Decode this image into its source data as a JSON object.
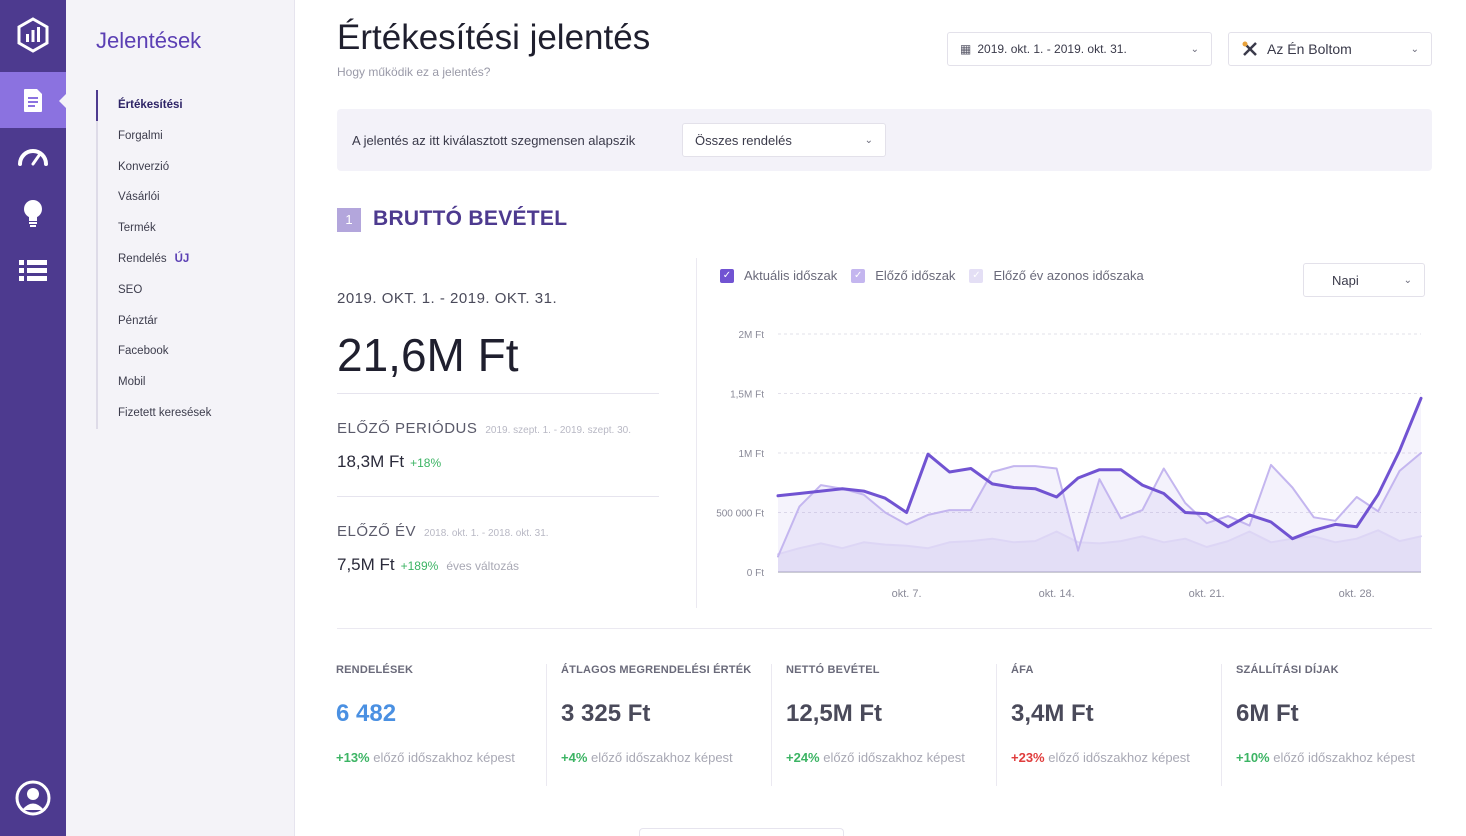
{
  "sidebar": {
    "title": "Jelentések",
    "items": [
      {
        "label": "Értékesítési",
        "active": true
      },
      {
        "label": "Forgalmi"
      },
      {
        "label": "Konverzió"
      },
      {
        "label": "Vásárlói"
      },
      {
        "label": "Termék"
      },
      {
        "label": "Rendelés",
        "badge": "ÚJ"
      },
      {
        "label": "SEO"
      },
      {
        "label": "Pénztár"
      },
      {
        "label": "Facebook"
      },
      {
        "label": "Mobil"
      },
      {
        "label": "Fizetett keresések"
      }
    ]
  },
  "header": {
    "title": "Értékesítési jelentés",
    "subtitle": "Hogy működik ez a jelentés?",
    "date_range": "2019. okt. 1. - 2019. okt. 31.",
    "shop": "Az Én Boltom"
  },
  "segment": {
    "label": "A jelentés az itt kiválasztott szegmensen alapszik",
    "value": "Összes rendelés"
  },
  "section": {
    "number": "1",
    "title": "BRUTTÓ BEVÉTEL"
  },
  "summary": {
    "range": "2019. OKT. 1. - 2019. OKT. 31.",
    "value": "21,6M Ft",
    "prev_period": {
      "label": "ELŐZŐ PERIÓDUS",
      "range": "2019. szept. 1. - 2019. szept. 30.",
      "value": "18,3M Ft",
      "change": "+18%"
    },
    "prev_year": {
      "label": "ELŐZŐ ÉV",
      "range": "2018. okt. 1. - 2018. okt. 31.",
      "value": "7,5M Ft",
      "change": "+189%",
      "note": "éves változás"
    }
  },
  "chart_legend": {
    "current": "Aktuális időszak",
    "previous": "Előző időszak",
    "prev_year": "Előző év azonos időszaka",
    "granularity": "Napi"
  },
  "colors": {
    "primary": "#4d3a8f",
    "accent": "#8b72e0",
    "current_line": "#7153d2",
    "previous_line": "#c4b6ef",
    "prev_year_line": "#ddd6f5",
    "positive": "#3cb464",
    "negative": "#e03c3c",
    "link_blue": "#4a90e2"
  },
  "chart_data": {
    "type": "line",
    "x": [
      1,
      2,
      3,
      4,
      5,
      6,
      7,
      8,
      9,
      10,
      11,
      12,
      13,
      14,
      15,
      16,
      17,
      18,
      19,
      20,
      21,
      22,
      23,
      24,
      25,
      26,
      27,
      28,
      29,
      30,
      31
    ],
    "x_ticks": [
      {
        "x": 7,
        "label": "okt. 7."
      },
      {
        "x": 14,
        "label": "okt. 14."
      },
      {
        "x": 21,
        "label": "okt. 21."
      },
      {
        "x": 28,
        "label": "okt. 28."
      }
    ],
    "y_ticks": [
      {
        "y": 0,
        "label": "0 Ft"
      },
      {
        "y": 500000,
        "label": "500 000 Ft"
      },
      {
        "y": 1000000,
        "label": "1M Ft"
      },
      {
        "y": 1500000,
        "label": "1,5M Ft"
      },
      {
        "y": 2000000,
        "label": "2M Ft"
      }
    ],
    "ylim": [
      0,
      2000000
    ],
    "grid": true,
    "series": [
      {
        "name": "Aktuális időszak",
        "values": [
          640000,
          660000,
          680000,
          700000,
          680000,
          620000,
          500000,
          990000,
          840000,
          870000,
          740000,
          710000,
          700000,
          630000,
          790000,
          860000,
          860000,
          730000,
          660000,
          500000,
          490000,
          380000,
          480000,
          420000,
          280000,
          350000,
          400000,
          380000,
          650000,
          1020000,
          1460000
        ]
      },
      {
        "name": "Előző időszak",
        "values": [
          130000,
          550000,
          730000,
          700000,
          650000,
          500000,
          400000,
          480000,
          520000,
          520000,
          840000,
          890000,
          890000,
          870000,
          180000,
          780000,
          450000,
          520000,
          870000,
          580000,
          410000,
          470000,
          390000,
          900000,
          710000,
          460000,
          430000,
          630000,
          510000,
          850000,
          1000000
        ]
      },
      {
        "name": "Előző év azonos időszaka",
        "values": [
          150000,
          200000,
          240000,
          200000,
          250000,
          230000,
          220000,
          200000,
          250000,
          260000,
          280000,
          250000,
          260000,
          340000,
          250000,
          240000,
          260000,
          300000,
          250000,
          280000,
          210000,
          260000,
          340000,
          250000,
          280000,
          300000,
          250000,
          280000,
          350000,
          260000,
          300000
        ]
      }
    ]
  },
  "kpis": [
    {
      "label": "RENDELÉSEK",
      "value": "6 482",
      "change": "+13%",
      "change_text": "előző időszakhoz képest",
      "trend": "up"
    },
    {
      "label": "ÁTLAGOS MEGRENDELÉSI ÉRTÉK",
      "value": "3 325 Ft",
      "change": "+4%",
      "change_text": "előző időszakhoz képest",
      "trend": "up"
    },
    {
      "label": "NETTÓ BEVÉTEL",
      "value": "12,5M Ft",
      "change": "+24%",
      "change_text": "előző időszakhoz képest",
      "trend": "up"
    },
    {
      "label": "ÁFA",
      "value": "3,4M Ft",
      "change": "+23%",
      "change_text": "előző időszakhoz képest",
      "trend": "down"
    },
    {
      "label": "SZÁLLÍTÁSI DÍJAK",
      "value": "6M Ft",
      "change": "+10%",
      "change_text": "előző időszakhoz képest",
      "trend": "up"
    }
  ]
}
